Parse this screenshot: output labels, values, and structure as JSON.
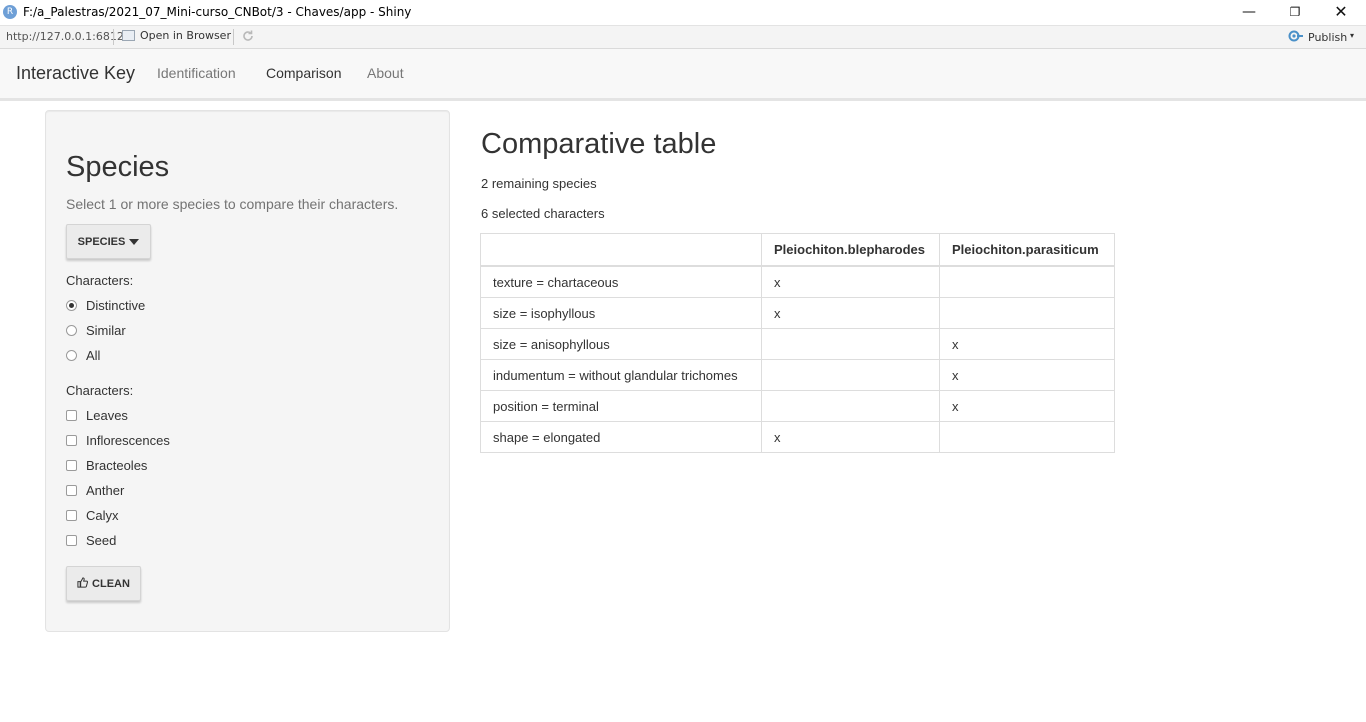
{
  "window": {
    "icon_letter": "R",
    "title": "F:/a_Palestras/2021_07_Mini-curso_CNBot/3 - Chaves/app - Shiny",
    "minimize_glyph": "—",
    "maximize_glyph": "❐",
    "close_glyph": "✕"
  },
  "viewer_toolbar": {
    "url": "http://127.0.0.1:6812",
    "open_in_browser": "Open in Browser",
    "refresh_icon": "refresh-icon",
    "publish": "Publish",
    "publish_icon": "publish-icon",
    "caret": "▾"
  },
  "navbar": {
    "brand": "Interactive Key",
    "tabs": [
      {
        "label": "Identification",
        "active": false
      },
      {
        "label": "Comparison",
        "active": true
      },
      {
        "label": "About",
        "active": false
      }
    ]
  },
  "sidebar": {
    "title": "Species",
    "help": "Select 1 or more species to compare their characters.",
    "species_button": "SPECIES",
    "radio_group": {
      "label": "Characters:",
      "options": [
        "Distinctive",
        "Similar",
        "All"
      ],
      "selected": "Distinctive"
    },
    "checkbox_group": {
      "label": "Characters:",
      "options": [
        "Leaves",
        "Inflorescences",
        "Bracteoles",
        "Anther",
        "Calyx",
        "Seed"
      ],
      "checked": []
    },
    "clean_button": "CLEAN",
    "clean_icon": "thumbs-up-icon"
  },
  "main": {
    "title": "Comparative table",
    "remaining": "2 remaining species",
    "selected": "6 selected characters",
    "table": {
      "headers": [
        "",
        "Pleiochiton.blepharodes",
        "Pleiochiton.parasiticum"
      ],
      "rows": [
        [
          "texture = chartaceous",
          "x",
          ""
        ],
        [
          "size = isophyllous",
          "x",
          ""
        ],
        [
          "size = anisophyllous",
          "",
          "x"
        ],
        [
          "indumentum = without glandular trichomes",
          "",
          "x"
        ],
        [
          "position = terminal",
          "",
          "x"
        ],
        [
          "shape = elongated",
          "x",
          ""
        ]
      ]
    }
  }
}
